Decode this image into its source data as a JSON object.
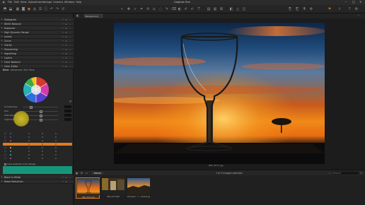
{
  "menubar": {
    "items": [
      "File",
      "Edit",
      "View",
      "Adjustments",
      "Image",
      "Camera",
      "Window",
      "Help"
    ],
    "title": "Capture One"
  },
  "tool_panel": {
    "tools": [
      {
        "label": "Histogram"
      },
      {
        "label": "White Balance"
      },
      {
        "label": "Exposure"
      },
      {
        "label": "High Dynamic Range"
      },
      {
        "label": "Levels"
      },
      {
        "label": "Curve"
      },
      {
        "label": "Clarity"
      },
      {
        "label": "Sharpening"
      },
      {
        "label": "Vignetting"
      },
      {
        "label": "Layers"
      },
      {
        "label": "Color Balance"
      },
      {
        "label": "Color Editor"
      }
    ],
    "color_editor_tabs": [
      "Basic",
      "Advanced",
      "Skin Tone"
    ],
    "active_tab": "Basic",
    "sliders": [
      {
        "label": "Smoothness"
      },
      {
        "label": "Hue"
      },
      {
        "label": "Saturation"
      },
      {
        "label": "Lightness"
      }
    ],
    "view_selected_label": "View Selected Color Range",
    "bottom_tools": [
      {
        "label": "Black & White"
      },
      {
        "label": "Noise Reduction"
      }
    ]
  },
  "color_table": {
    "rows": [
      {
        "color": "#3d5bd6",
        "values": [
          "0",
          "0",
          "0"
        ]
      },
      {
        "color": "#5a4bd0",
        "values": [
          "0",
          "0",
          "0"
        ]
      },
      {
        "color": "#d44a3a",
        "values": [
          "0",
          "0",
          "0"
        ]
      },
      {
        "color": "#e8841e",
        "values": [
          "0",
          "0",
          "0"
        ],
        "selected": true
      },
      {
        "color": "#f0c820",
        "values": [
          "0",
          "0",
          "0"
        ]
      },
      {
        "color": "#3aa858",
        "values": [
          "0",
          "0",
          "0"
        ]
      },
      {
        "color": "#2ec0c8",
        "values": [
          "0",
          "0",
          "0"
        ]
      },
      {
        "color": "#c84ab8",
        "values": [
          "0",
          "0",
          "0"
        ]
      }
    ]
  },
  "viewer": {
    "variant": "Background",
    "image_name": "IMG_3071.jpg"
  },
  "browser": {
    "tab_label": "Name",
    "status": "1 of 3 Images selected",
    "search_placeholder": "Search",
    "thumbnails": [
      {
        "name": "IMG_3071.jpg",
        "selected": true
      },
      {
        "name": "IMG_0274.JPG"
      },
      {
        "name": "Preview1 - 1 - vertical.jpg"
      }
    ]
  },
  "colors": {
    "accent": "#e37a1e",
    "selected_range": "#17957a"
  },
  "icons": [
    "import-icon",
    "export-icon",
    "undo-icon",
    "redo-icon",
    "crop-icon",
    "rotate-icon",
    "keystone-icon",
    "pan-icon",
    "zoom-icon",
    "picker-icon",
    "brush-icon",
    "eraser-icon",
    "settings-icon",
    "help-icon"
  ]
}
